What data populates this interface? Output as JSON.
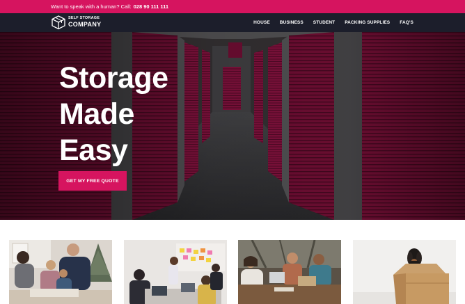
{
  "topbar": {
    "prompt": "Want to speak with a human? Call:",
    "phone": "028 90 111 111"
  },
  "logo": {
    "line1": "SELF STORAGE",
    "line2": "COMPANY"
  },
  "nav": {
    "items": [
      {
        "label": "HOUSE"
      },
      {
        "label": "BUSINESS"
      },
      {
        "label": "STUDENT"
      },
      {
        "label": "PACKING SUPPLIES"
      },
      {
        "label": "FAQ'S"
      }
    ]
  },
  "hero": {
    "title_lines": [
      "Storage",
      "Made",
      "Easy"
    ],
    "cta_label": "GET MY FREE QUOTE"
  },
  "colors": {
    "brand_pink": "#d6145f",
    "nav_dark": "#1c1e2b"
  },
  "cards": [
    {
      "image": "family-with-christmas-tree-photo"
    },
    {
      "image": "student-meeting-with-sticky-notes-photo"
    },
    {
      "image": "business-team-with-laptops-photo"
    },
    {
      "image": "dachshund-in-cardboard-box-photo"
    }
  ]
}
